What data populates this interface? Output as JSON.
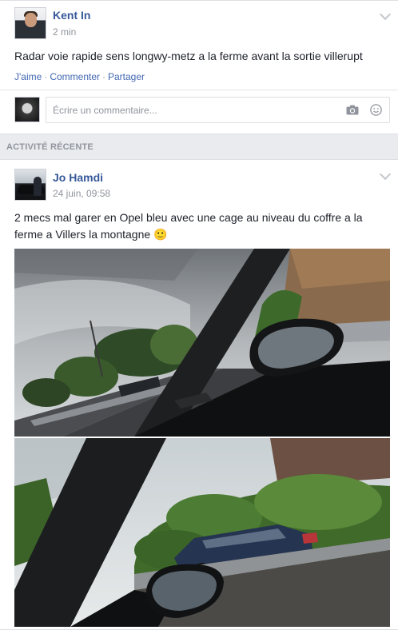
{
  "post1": {
    "author": "Kent In",
    "time": "2 min",
    "text": "Radar voie rapide sens longwy-metz a la ferme avant la sortie villerupt",
    "actions": {
      "like": "J'aime",
      "comment": "Commenter",
      "share": "Partager"
    },
    "comment_placeholder": "Écrire un commentaire..."
  },
  "section_label": "ACTIVITÉ RÉCENTE",
  "post2": {
    "author": "Jo Hamdi",
    "time": "24 juin, 09:58",
    "text_line1": "2 mecs mal garer en Opel bleu avec une cage au niveau du coffre a la",
    "text_line2": "ferme a Villers la montagne 🙂"
  },
  "colors": {
    "link": "#365899",
    "action": "#4267b2",
    "muted": "#90949c",
    "background": "#e9ebee"
  },
  "icons": [
    "chevron-down-icon",
    "camera-icon",
    "smiley-icon"
  ]
}
